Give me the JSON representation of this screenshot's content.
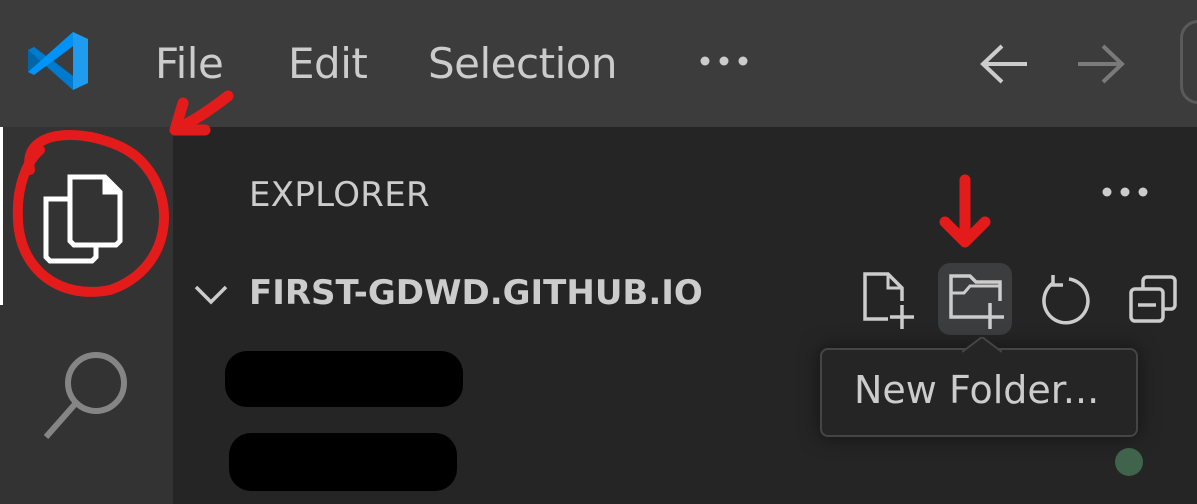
{
  "titlebar": {
    "menu": [
      "File",
      "Edit",
      "Selection"
    ],
    "more_icon": "ellipsis-icon",
    "back_icon": "arrow-left-icon",
    "forward_icon": "arrow-right-icon"
  },
  "activitybar": {
    "items": [
      {
        "name": "explorer",
        "icon": "files-icon",
        "active": true
      },
      {
        "name": "search",
        "icon": "search-icon",
        "active": false
      }
    ]
  },
  "sidebar": {
    "title": "EXPLORER",
    "folder": {
      "name": "FIRST-GDWD.GITHUB.IO",
      "expanded": true,
      "redacted_items": 2
    },
    "actions": [
      {
        "name": "new-file",
        "icon": "new-file-icon"
      },
      {
        "name": "new-folder",
        "icon": "new-folder-icon",
        "hovered": true
      },
      {
        "name": "refresh",
        "icon": "refresh-icon"
      },
      {
        "name": "collapse-all",
        "icon": "collapse-all-icon"
      }
    ]
  },
  "tooltip": {
    "text": "New Folder..."
  },
  "colors": {
    "titlebar": "#3c3c3c",
    "activitybar": "#333333",
    "sidebar": "#252526",
    "annotation": "#e31b1b",
    "vscode_blue": "#0078d4",
    "status_dot": "#3f634b"
  }
}
